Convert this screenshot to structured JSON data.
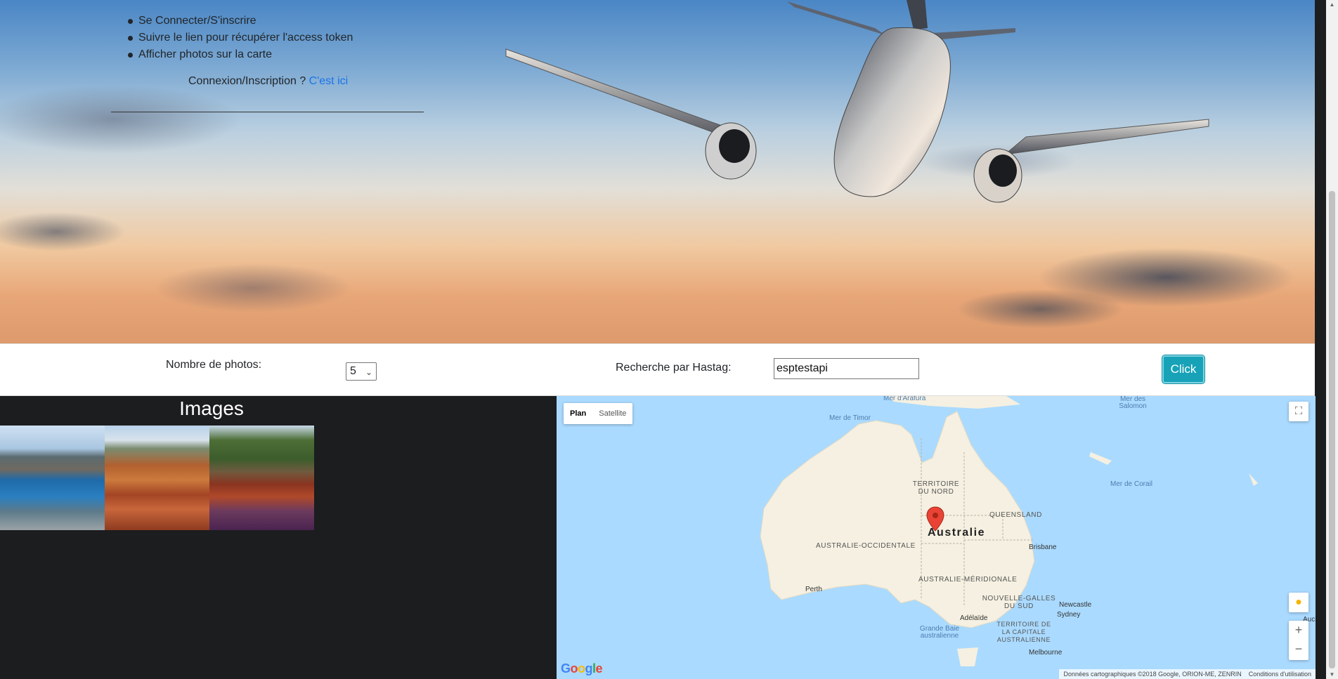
{
  "hero": {
    "steps": [
      "Se Connecter/S'inscrire",
      "Suivre le lien pour récupérer l'access token",
      "Afficher photos sur la carte"
    ],
    "login_prompt": "Connexion/Inscription ?",
    "login_link": "C'est ici"
  },
  "form": {
    "count_label": "Nombre de photos:",
    "count_value": "5",
    "hashtag_label": "Recherche par Hastag:",
    "hashtag_value": "esptestapi",
    "submit_label": "Click"
  },
  "images": {
    "title": "Images",
    "count_shown": 3
  },
  "map": {
    "tabs": [
      "Plan",
      "Satellite"
    ],
    "active_tab": "Plan",
    "country": "Australie",
    "regions": {
      "nt": "TERRITOIRE DU NORD",
      "qld": "QUEENSLAND",
      "wa": "AUSTRALIE-OCCIDENTALE",
      "sa": "AUSTRALIE-MÉRIDIONALE",
      "nsw": "NOUVELLE-GALLES DU SUD",
      "act": "TERRITOIRE DE LA CAPITALE AUSTRALIENNE"
    },
    "seas": {
      "arafura": "Mer d'Arafura",
      "timor": "Mer de Timor",
      "corail": "Mer de Corail",
      "salomon": "Mer des Salomon",
      "bight": "Grande Baie australienne"
    },
    "cities": {
      "perth": "Perth",
      "adelaide": "Adélaïde",
      "melbourne": "Melbourne",
      "brisbane": "Brisbane",
      "newcastle": "Newcastle",
      "sydney": "Sydney",
      "auckland": "Auckl"
    },
    "google": "Google",
    "attribution": "Données cartographiques ©2018 Google, ORION-ME, ZENRIN",
    "terms": "Conditions d'utilisation",
    "zoom_in": "+",
    "zoom_out": "−",
    "colors": {
      "water": "#aadaff",
      "land": "#f5f0e1",
      "marker": "#ea4335"
    }
  }
}
